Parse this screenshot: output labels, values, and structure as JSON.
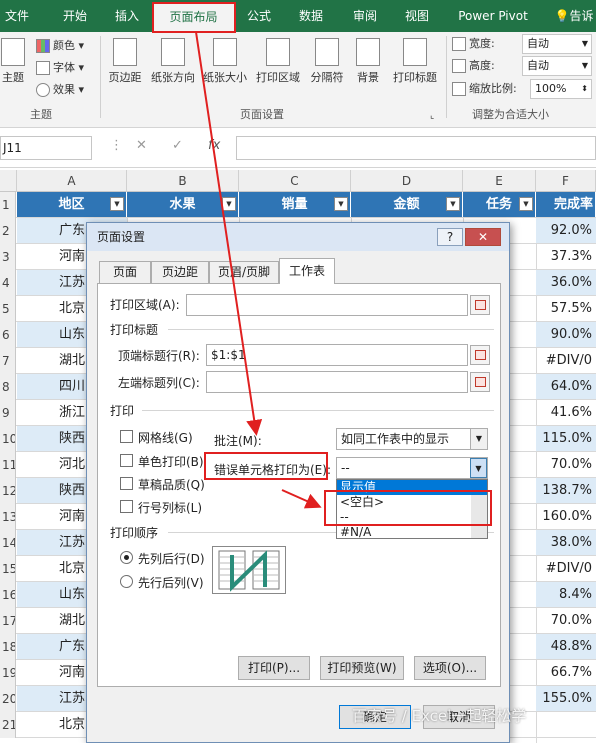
{
  "menu": {
    "tabs": [
      {
        "label": "文件"
      },
      {
        "label": "开始"
      },
      {
        "label": "插入"
      },
      {
        "label": "页面布局"
      },
      {
        "label": "公式"
      },
      {
        "label": "数据"
      },
      {
        "label": "审阅"
      },
      {
        "label": "视图"
      },
      {
        "label": "Power Pivot"
      },
      {
        "label": "告诉"
      }
    ],
    "active_tab": "页面布局"
  },
  "ribbon": {
    "theme_group": {
      "name": "主题",
      "theme_button": "主题",
      "colors": "颜色",
      "fonts": "字体",
      "effects": "效果"
    },
    "page_setup_group": {
      "name": "页面设置",
      "buttons": [
        "页边距",
        "纸张方向",
        "纸张大小",
        "打印区域",
        "分隔符",
        "背景",
        "打印标题"
      ]
    },
    "scale_group": {
      "name": "调整为合适大小",
      "width_label": "宽度:",
      "width_value": "自动",
      "height_label": "高度:",
      "height_value": "自动",
      "scale_label": "缩放比例:",
      "scale_value": "100%"
    }
  },
  "formula_bar": {
    "name_box": "J11",
    "cancel": "✕",
    "confirm": "✓",
    "fx": "fx"
  },
  "columns": [
    "A",
    "B",
    "C",
    "D",
    "E",
    "F"
  ],
  "header_row": {
    "row_num": "1",
    "cells": [
      "地区",
      "水果",
      "销量",
      "金额",
      "任务",
      "完成率"
    ]
  },
  "rows": [
    {
      "n": "2",
      "a": "广东",
      "f": "92.0%"
    },
    {
      "n": "3",
      "a": "河南",
      "f": "37.3%"
    },
    {
      "n": "4",
      "a": "江苏",
      "f": "36.0%"
    },
    {
      "n": "5",
      "a": "北京",
      "f": "57.5%"
    },
    {
      "n": "6",
      "a": "山东",
      "f": "90.0%"
    },
    {
      "n": "7",
      "a": "湖北",
      "f": "#DIV/0"
    },
    {
      "n": "8",
      "a": "四川",
      "f": "64.0%"
    },
    {
      "n": "9",
      "a": "浙江",
      "f": "41.6%"
    },
    {
      "n": "10",
      "a": "陕西",
      "f": "115.0%"
    },
    {
      "n": "11",
      "a": "河北",
      "f": "70.0%"
    },
    {
      "n": "12",
      "a": "陕西",
      "f": "138.7%"
    },
    {
      "n": "13",
      "a": "河南",
      "f": "160.0%"
    },
    {
      "n": "14",
      "a": "江苏",
      "f": "38.0%"
    },
    {
      "n": "15",
      "a": "北京",
      "f": "#DIV/0"
    },
    {
      "n": "16",
      "a": "山东",
      "f": "8.4%"
    },
    {
      "n": "17",
      "a": "湖北",
      "f": "70.0%"
    },
    {
      "n": "18",
      "a": "广东",
      "f": "48.8%"
    },
    {
      "n": "19",
      "a": "河南",
      "f": "66.7%"
    },
    {
      "n": "20",
      "a": "江苏",
      "f": "155.0%"
    },
    {
      "n": "21",
      "a": "北京",
      "f": ""
    }
  ],
  "dialog": {
    "title": "页面设置",
    "help": "?",
    "close": "✕",
    "tabs": [
      "页面",
      "页边距",
      "页眉/页脚",
      "工作表"
    ],
    "active_tab": "工作表",
    "print_area_label": "打印区域(A):",
    "print_area_value": "",
    "print_titles_section": "打印标题",
    "top_rows_label": "顶端标题行(R):",
    "top_rows_value": "$1:$1",
    "left_cols_label": "左端标题列(C):",
    "left_cols_value": "",
    "print_section": "打印",
    "gridlines": "网格线(G)",
    "mono": "单色打印(B)",
    "draft": "草稿品质(Q)",
    "row_col_headers": "行号列标(L)",
    "comments_label": "批注(M):",
    "comments_value": "如同工作表中的显示",
    "errors_label": "错误单元格打印为(E):",
    "errors_value": "--",
    "errors_options": [
      "显示值",
      "<空白>",
      "--",
      "#N/A"
    ],
    "errors_highlight": "显示值",
    "page_order_section": "打印顺序",
    "down_then_over": "先列后行(D)",
    "over_then_down": "先行后列(V)",
    "print_btn": "打印(P)...",
    "preview_btn": "打印预览(W)",
    "options_btn": "选项(O)...",
    "ok_btn": "确定",
    "cancel_btn": "取消"
  },
  "watermark": "百家号 / Excel一起轻松学",
  "colors": {
    "excel_green": "#217346",
    "header_blue": "#2f75b5",
    "band_blue": "#ddebf7",
    "annotation_red": "#e02020"
  }
}
